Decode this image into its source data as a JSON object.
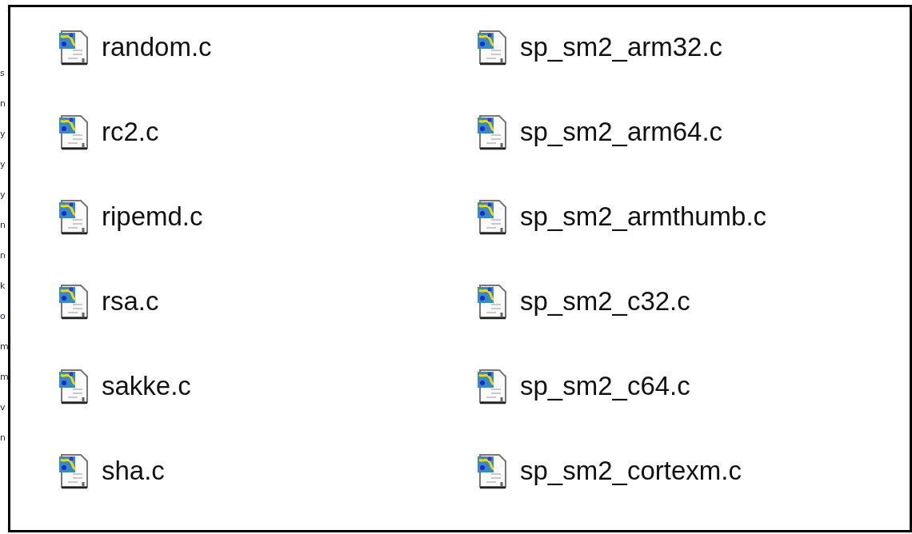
{
  "background_fragments": [
    "s",
    "n",
    "y",
    "y",
    "y",
    "n",
    "n",
    "k",
    "o",
    "m",
    "m",
    "v",
    "n"
  ],
  "files": [
    {
      "name": "random.c"
    },
    {
      "name": "sp_sm2_arm32.c"
    },
    {
      "name": "rc2.c"
    },
    {
      "name": "sp_sm2_arm64.c"
    },
    {
      "name": "ripemd.c"
    },
    {
      "name": "sp_sm2_armthumb.c"
    },
    {
      "name": "rsa.c"
    },
    {
      "name": "sp_sm2_c32.c"
    },
    {
      "name": "sakke.c"
    },
    {
      "name": "sp_sm2_c64.c"
    },
    {
      "name": "sha.c"
    },
    {
      "name": "sp_sm2_cortexm.c"
    }
  ]
}
